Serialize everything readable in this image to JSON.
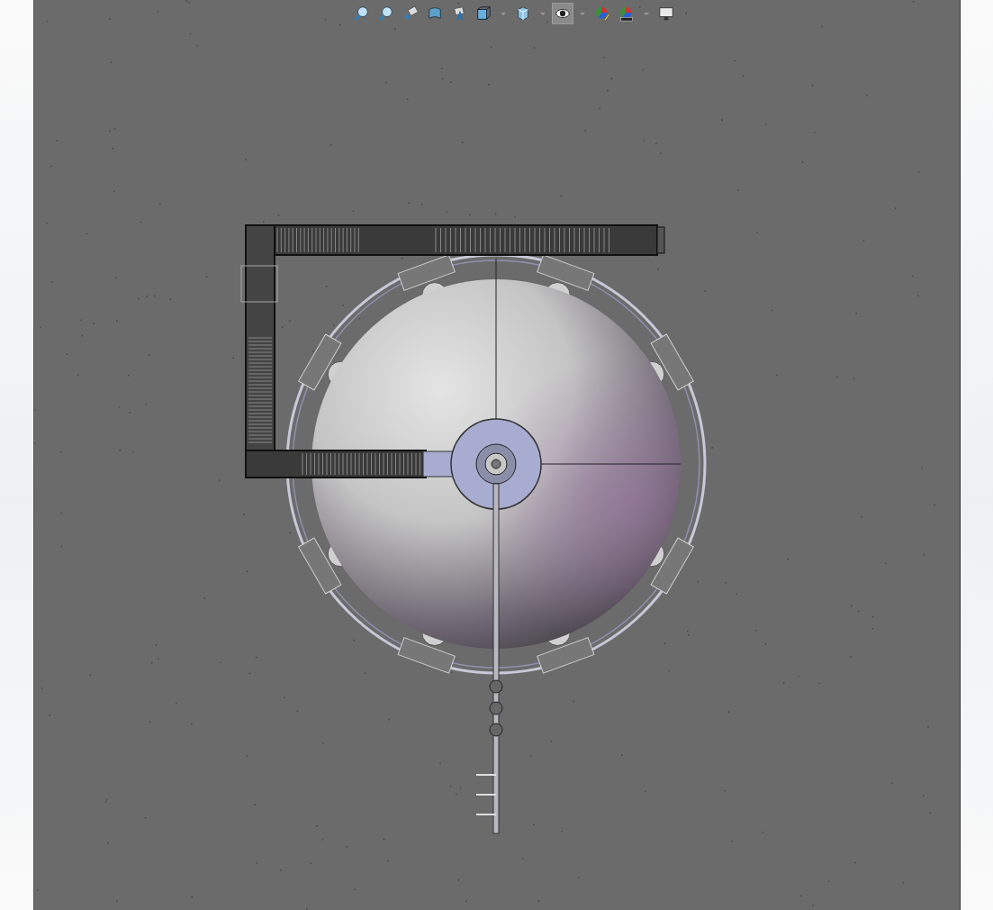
{
  "toolbar": [
    {
      "kind": "zoom-fit",
      "selected": false
    },
    {
      "kind": "zoom-area",
      "selected": false
    },
    {
      "kind": "previous-view",
      "selected": false
    },
    {
      "kind": "section-view",
      "selected": false
    },
    {
      "kind": "annotation",
      "selected": false
    },
    {
      "kind": "view-orientation",
      "selected": false
    },
    {
      "kind": "display-style",
      "selected": false
    },
    {
      "kind": "hide-show",
      "selected": true
    },
    {
      "kind": "appearance",
      "selected": false
    },
    {
      "kind": "scene",
      "selected": false
    },
    {
      "kind": "monitor",
      "selected": false
    }
  ]
}
